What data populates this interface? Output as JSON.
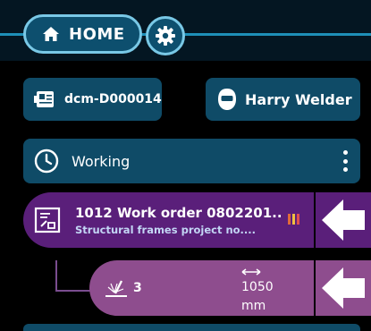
{
  "nav": {
    "home_label": "HOME",
    "home_icon": "home-icon",
    "settings_icon": "gear-icon"
  },
  "device": {
    "label": "dcm-D000014",
    "icon": "machine-icon"
  },
  "user": {
    "label": "Harry Welder",
    "icon": "welder-mask-icon"
  },
  "status": {
    "label": "Working",
    "icon": "clock-icon",
    "menu_icon": "kebab-menu-icon"
  },
  "work_order": {
    "title": "1012 Work order 0802201...",
    "subtitle": "Structural frames project no....",
    "icon": "document-icon",
    "status_bar_colors": [
      "#e06a3a",
      "#f0c040",
      "#e05050"
    ]
  },
  "weld_step": {
    "count": "3",
    "length_value": "1050",
    "length_unit": "mm",
    "icon": "weld-torch-icon",
    "length_icon": "length-arrow-icon"
  },
  "colors": {
    "accent": "#79c8e6",
    "card": "#0f4b67",
    "work_order_bg": "#5a1f7a",
    "step_bg": "#8e4d8e"
  }
}
